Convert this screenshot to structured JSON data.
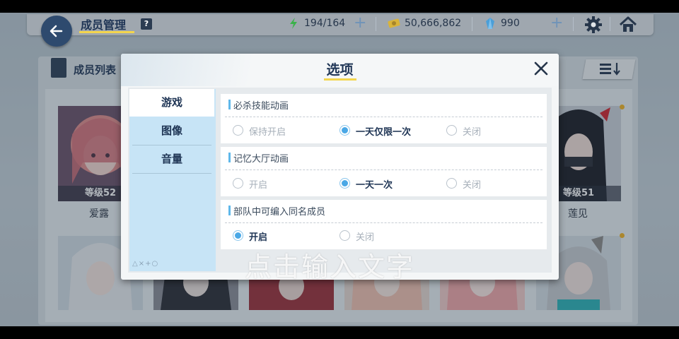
{
  "header": {
    "title": "成员管理",
    "help_label": "?",
    "ap": "194/164",
    "credits": "50,666,862",
    "gems": "990",
    "plus": "+"
  },
  "list": {
    "title": "成员列表",
    "left_cards": [
      {
        "level": "等级52",
        "name": "爱露"
      }
    ],
    "right_cards": [
      {
        "level": "等级51",
        "name": "莲见"
      }
    ]
  },
  "dialog": {
    "title": "选项",
    "tabs": [
      "游戏",
      "图像",
      "音量"
    ],
    "tab_footer": "△×+○",
    "options": [
      {
        "label": "必杀技能动画",
        "choices": [
          "保持开启",
          "一天仅限一次",
          "关闭"
        ],
        "selected": 1
      },
      {
        "label": "记忆大厅动画",
        "choices": [
          "开启",
          "一天一次",
          "关闭"
        ],
        "selected": 1
      },
      {
        "label": "部队中可编入同名成员",
        "choices": [
          "开启",
          "关闭"
        ],
        "selected": 0
      }
    ]
  },
  "overlay_text": "点击输入文字",
  "colors": {
    "accent": "#4aa8e6",
    "title": "#1f3555",
    "underline": "#f3d54d",
    "tab_bg": "#c7e4f6"
  }
}
